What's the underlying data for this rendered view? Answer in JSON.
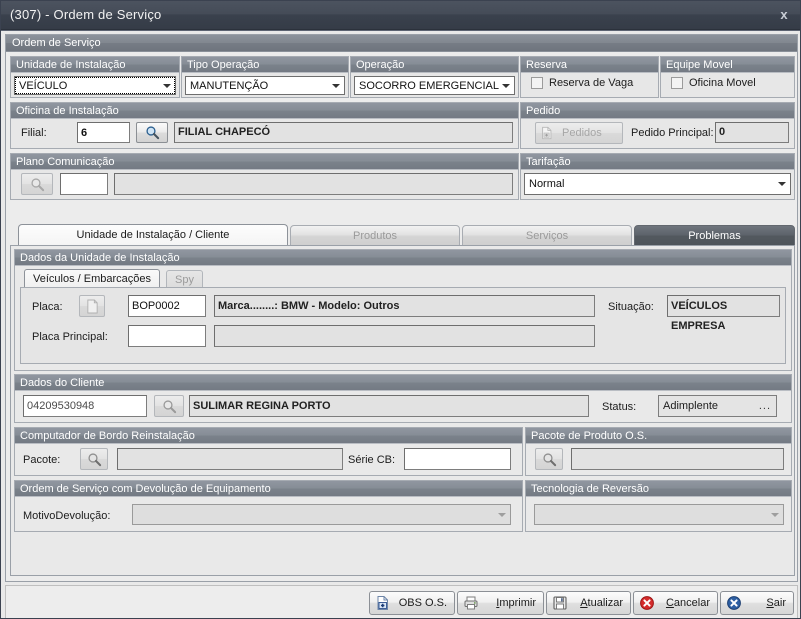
{
  "window": {
    "title": "(307) - Ordem de Serviço",
    "close_label": "x"
  },
  "outer_group": {
    "caption": "Ordem de Serviço"
  },
  "top_row": {
    "unidade_instalacao": {
      "caption": "Unidade de Instalação",
      "value": "VEÍCULO"
    },
    "tipo_operacao": {
      "caption": "Tipo Operação",
      "value": "MANUTENÇÃO"
    },
    "operacao": {
      "caption": "Operação",
      "value": "SOCORRO EMERGENCIAL"
    },
    "reserva": {
      "caption": "Reserva",
      "checkbox_label": "Reserva de Vaga",
      "checked": false
    },
    "equipe_movel": {
      "caption": "Equipe Movel",
      "checkbox_label": "Oficina Movel",
      "checked": false
    }
  },
  "oficina_instalacao": {
    "caption": "Oficina de Instalação",
    "filial_label": "Filial:",
    "filial_value": "6",
    "search_icon": "magnifier-icon",
    "filial_name": "FILIAL CHAPECÓ"
  },
  "pedido": {
    "caption": "Pedido",
    "button_label": "Pedidos",
    "button_icon": "document-add-icon",
    "principal_label": "Pedido Principal:",
    "principal_value": "0"
  },
  "plano_comunicacao": {
    "caption": "Plano Comunicação",
    "search_icon": "magnifier-icon",
    "code_value": "",
    "description_value": ""
  },
  "tarifacao": {
    "caption": "Tarifação",
    "value": "Normal"
  },
  "main_tabs": [
    {
      "label": "Unidade de Instalação / Cliente",
      "state": "active"
    },
    {
      "label": "Produtos",
      "state": "idle"
    },
    {
      "label": "Serviços",
      "state": "idle"
    },
    {
      "label": "Problemas",
      "state": "dark"
    }
  ],
  "dados_unidade": {
    "caption": "Dados da Unidade de Instalação",
    "sub_tabs": [
      {
        "label": "Veículos / Embarcações",
        "state": "active"
      },
      {
        "label": "Spy",
        "state": "idle"
      }
    ],
    "placa_label": "Placa:",
    "placa_icon": "document-icon",
    "placa_value": "BOP0002",
    "marca_modelo": "Marca........: BMW - Modelo: Outros",
    "situacao_label": "Situação:",
    "situacao_value": "VEÍCULOS EMPRESA",
    "placa_principal_label": "Placa Principal:",
    "placa_principal_value": "",
    "placa_principal_desc": ""
  },
  "dados_cliente": {
    "caption": "Dados do Cliente",
    "codigo_value": "04209530948",
    "search_icon": "magnifier-icon",
    "nome_value": "SULIMAR REGINA PORTO",
    "status_label": "Status:",
    "status_value": "Adimplente",
    "status_dots": "..."
  },
  "computador_bordo": {
    "caption": "Computador de Bordo Reinstalação",
    "pacote_label": "Pacote:",
    "search_icon": "magnifier-icon",
    "pacote_value": "",
    "serie_label": "Série CB:",
    "serie_value": ""
  },
  "pacote_produto": {
    "caption": "Pacote de Produto O.S.",
    "search_icon": "magnifier-icon",
    "value": ""
  },
  "devolucao": {
    "caption": "Ordem de Serviço com Devolução de Equipamento",
    "motivo_label": "MotivoDevolução:",
    "motivo_value": ""
  },
  "tecnologia_reversao": {
    "caption": "Tecnologia de Reversão",
    "value": ""
  },
  "actions": [
    {
      "label": "OBS O.S.",
      "icon": "document-add-icon",
      "accel": ""
    },
    {
      "label": "Imprimir",
      "icon": "printer-icon",
      "accel": "I"
    },
    {
      "label": "Atualizar",
      "icon": "save-disk-icon",
      "accel": "A"
    },
    {
      "label": "Cancelar",
      "icon": "cancel-circle-icon",
      "accel": "C"
    },
    {
      "label": "Sair",
      "icon": "exit-circle-icon",
      "accel": "S"
    }
  ],
  "colors": {
    "titlebar": "#454c58",
    "group_caption": "#81878f",
    "dark_tab": "#5d636b",
    "cancel_red": "#cc2222",
    "exit_blue": "#2b4f8e"
  }
}
